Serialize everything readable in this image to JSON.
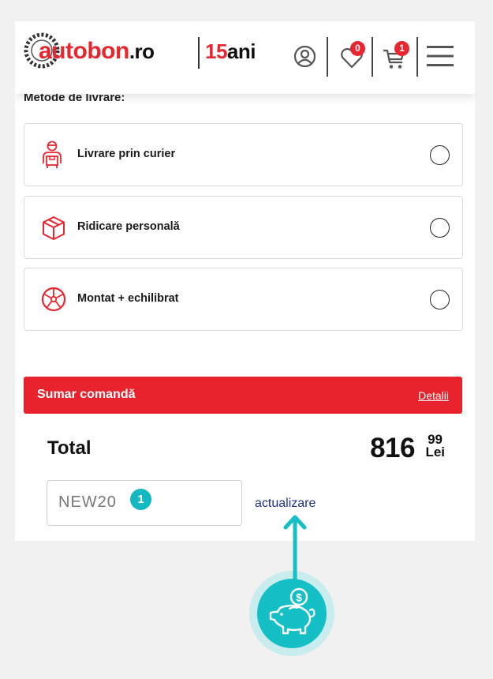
{
  "header": {
    "logo_text": "autobon",
    "logo_domain": ".ro",
    "anniversary_number": "15",
    "anniversary_word": "ani",
    "wishlist_count": "0",
    "cart_count": "1",
    "icons": [
      "account-icon",
      "heart-icon",
      "cart-icon",
      "menu-icon"
    ]
  },
  "delivery": {
    "title": "Metode de livrare:",
    "options": [
      {
        "label": "Livrare prin curier",
        "icon": "courier-icon",
        "selected": false
      },
      {
        "label": "Ridicare personală",
        "icon": "box-icon",
        "selected": false
      },
      {
        "label": "Montat + echilibrat",
        "icon": "wheel-icon",
        "selected": false
      }
    ]
  },
  "summary": {
    "title": "Sumar comandă",
    "details_link": "Detalii",
    "total_label": "Total",
    "total_integer": "816",
    "total_decimals": "99",
    "currency": "Lei"
  },
  "coupon": {
    "value": "NEW20",
    "placeholder": "",
    "update_label": "actualizare",
    "step_number": "1"
  },
  "colors": {
    "brand_red": "#e8232d",
    "accent_teal": "#14bfc6",
    "link_blue": "#1d2f8a"
  }
}
